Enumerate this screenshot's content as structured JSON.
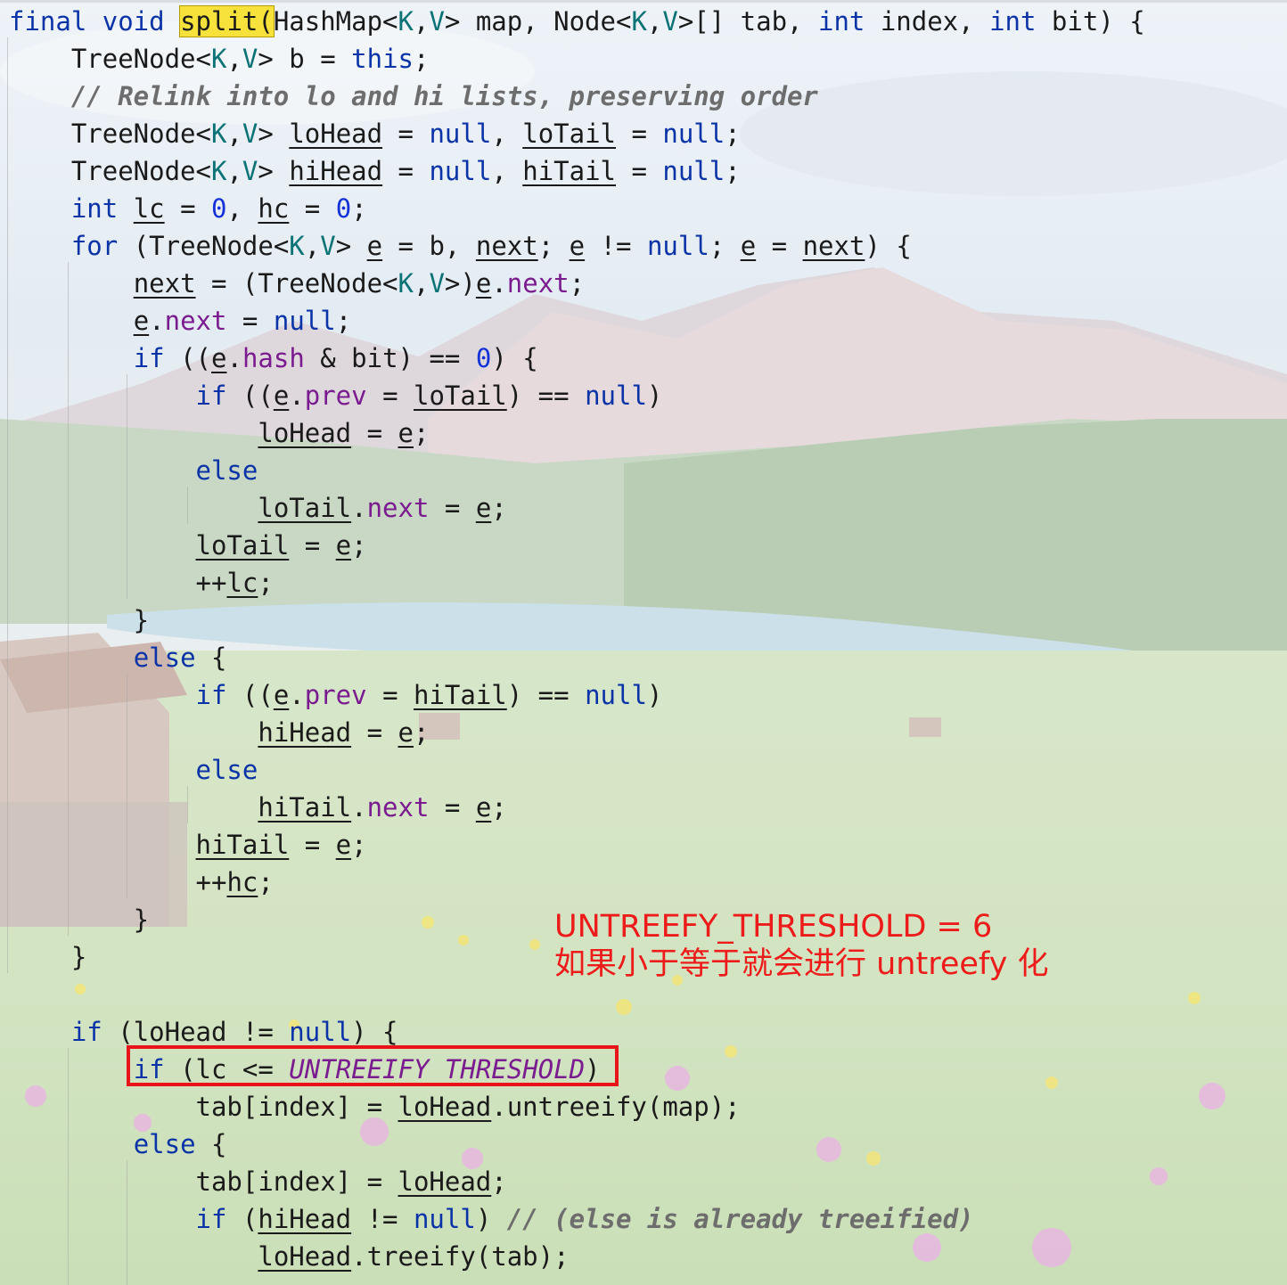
{
  "code_lines": [
    [
      {
        "t": "final void ",
        "c": "kw"
      },
      {
        "t": "split(",
        "c": "hl"
      },
      {
        "t": "HashMap<"
      },
      {
        "t": "K",
        "c": "tp"
      },
      {
        "t": ","
      },
      {
        "t": "V",
        "c": "tp"
      },
      {
        "t": "> map, Node<"
      },
      {
        "t": "K",
        "c": "tp"
      },
      {
        "t": ","
      },
      {
        "t": "V",
        "c": "tp"
      },
      {
        "t": ">[] tab, "
      },
      {
        "t": "int",
        "c": "kw"
      },
      {
        "t": " index, "
      },
      {
        "t": "int",
        "c": "kw"
      },
      {
        "t": " bit) {"
      }
    ],
    [
      {
        "t": "    TreeNode<"
      },
      {
        "t": "K",
        "c": "tp"
      },
      {
        "t": ","
      },
      {
        "t": "V",
        "c": "tp"
      },
      {
        "t": "> b = "
      },
      {
        "t": "this",
        "c": "kw"
      },
      {
        "t": ";"
      }
    ],
    [
      {
        "t": "    // Relink into lo and hi lists, preserving order",
        "c": "cm"
      }
    ],
    [
      {
        "t": "    TreeNode<"
      },
      {
        "t": "K",
        "c": "tp"
      },
      {
        "t": ","
      },
      {
        "t": "V",
        "c": "tp"
      },
      {
        "t": "> "
      },
      {
        "t": "loHead",
        "c": "ul"
      },
      {
        "t": " = "
      },
      {
        "t": "null",
        "c": "kw"
      },
      {
        "t": ", "
      },
      {
        "t": "loTail",
        "c": "ul"
      },
      {
        "t": " = "
      },
      {
        "t": "null",
        "c": "kw"
      },
      {
        "t": ";"
      }
    ],
    [
      {
        "t": "    TreeNode<"
      },
      {
        "t": "K",
        "c": "tp"
      },
      {
        "t": ","
      },
      {
        "t": "V",
        "c": "tp"
      },
      {
        "t": "> "
      },
      {
        "t": "hiHead",
        "c": "ul"
      },
      {
        "t": " = "
      },
      {
        "t": "null",
        "c": "kw"
      },
      {
        "t": ", "
      },
      {
        "t": "hiTail",
        "c": "ul"
      },
      {
        "t": " = "
      },
      {
        "t": "null",
        "c": "kw"
      },
      {
        "t": ";"
      }
    ],
    [
      {
        "t": "    "
      },
      {
        "t": "int",
        "c": "kw"
      },
      {
        "t": " "
      },
      {
        "t": "lc",
        "c": "ul"
      },
      {
        "t": " = "
      },
      {
        "t": "0",
        "c": "num"
      },
      {
        "t": ", "
      },
      {
        "t": "hc",
        "c": "ul"
      },
      {
        "t": " = "
      },
      {
        "t": "0",
        "c": "num"
      },
      {
        "t": ";"
      }
    ],
    [
      {
        "t": "    "
      },
      {
        "t": "for",
        "c": "kw"
      },
      {
        "t": " (TreeNode<"
      },
      {
        "t": "K",
        "c": "tp"
      },
      {
        "t": ","
      },
      {
        "t": "V",
        "c": "tp"
      },
      {
        "t": "> "
      },
      {
        "t": "e",
        "c": "ul"
      },
      {
        "t": " = b, "
      },
      {
        "t": "next",
        "c": "ul"
      },
      {
        "t": "; "
      },
      {
        "t": "e",
        "c": "ul"
      },
      {
        "t": " != "
      },
      {
        "t": "null",
        "c": "kw"
      },
      {
        "t": "; "
      },
      {
        "t": "e",
        "c": "ul"
      },
      {
        "t": " = "
      },
      {
        "t": "next",
        "c": "ul"
      },
      {
        "t": ") {"
      }
    ],
    [
      {
        "t": "        "
      },
      {
        "t": "next",
        "c": "ul"
      },
      {
        "t": " = (TreeNode<"
      },
      {
        "t": "K",
        "c": "tp"
      },
      {
        "t": ","
      },
      {
        "t": "V",
        "c": "tp"
      },
      {
        "t": ">)"
      },
      {
        "t": "e",
        "c": "ul"
      },
      {
        "t": "."
      },
      {
        "t": "next",
        "c": "fld"
      },
      {
        "t": ";"
      }
    ],
    [
      {
        "t": "        "
      },
      {
        "t": "e",
        "c": "ul"
      },
      {
        "t": "."
      },
      {
        "t": "next",
        "c": "fld"
      },
      {
        "t": " = "
      },
      {
        "t": "null",
        "c": "kw"
      },
      {
        "t": ";"
      }
    ],
    [
      {
        "t": "        "
      },
      {
        "t": "if",
        "c": "kw"
      },
      {
        "t": " (("
      },
      {
        "t": "e",
        "c": "ul"
      },
      {
        "t": "."
      },
      {
        "t": "hash",
        "c": "fld"
      },
      {
        "t": " & bit) == "
      },
      {
        "t": "0",
        "c": "num"
      },
      {
        "t": ") {"
      }
    ],
    [
      {
        "t": "            "
      },
      {
        "t": "if",
        "c": "kw"
      },
      {
        "t": " (("
      },
      {
        "t": "e",
        "c": "ul"
      },
      {
        "t": "."
      },
      {
        "t": "prev",
        "c": "fld"
      },
      {
        "t": " = "
      },
      {
        "t": "loTail",
        "c": "ul"
      },
      {
        "t": ") == "
      },
      {
        "t": "null",
        "c": "kw"
      },
      {
        "t": ")"
      }
    ],
    [
      {
        "t": "                "
      },
      {
        "t": "loHead",
        "c": "ul"
      },
      {
        "t": " = "
      },
      {
        "t": "e",
        "c": "ul"
      },
      {
        "t": ";"
      }
    ],
    [
      {
        "t": "            "
      },
      {
        "t": "else",
        "c": "kw"
      }
    ],
    [
      {
        "t": "                "
      },
      {
        "t": "loTail",
        "c": "ul"
      },
      {
        "t": "."
      },
      {
        "t": "next",
        "c": "fld"
      },
      {
        "t": " = "
      },
      {
        "t": "e",
        "c": "ul"
      },
      {
        "t": ";"
      }
    ],
    [
      {
        "t": "            "
      },
      {
        "t": "loTail",
        "c": "ul"
      },
      {
        "t": " = "
      },
      {
        "t": "e",
        "c": "ul"
      },
      {
        "t": ";"
      }
    ],
    [
      {
        "t": "            ++"
      },
      {
        "t": "lc",
        "c": "ul"
      },
      {
        "t": ";"
      }
    ],
    [
      {
        "t": "        }"
      }
    ],
    [
      {
        "t": "        "
      },
      {
        "t": "else",
        "c": "kw"
      },
      {
        "t": " {"
      }
    ],
    [
      {
        "t": "            "
      },
      {
        "t": "if",
        "c": "kw"
      },
      {
        "t": " (("
      },
      {
        "t": "e",
        "c": "ul"
      },
      {
        "t": "."
      },
      {
        "t": "prev",
        "c": "fld"
      },
      {
        "t": " = "
      },
      {
        "t": "hiTail",
        "c": "ul"
      },
      {
        "t": ") == "
      },
      {
        "t": "null",
        "c": "kw"
      },
      {
        "t": ")"
      }
    ],
    [
      {
        "t": "                "
      },
      {
        "t": "hiHead",
        "c": "ul"
      },
      {
        "t": " = "
      },
      {
        "t": "e",
        "c": "ul"
      },
      {
        "t": ";"
      }
    ],
    [
      {
        "t": "            "
      },
      {
        "t": "else",
        "c": "kw"
      }
    ],
    [
      {
        "t": "                "
      },
      {
        "t": "hiTail",
        "c": "ul"
      },
      {
        "t": "."
      },
      {
        "t": "next",
        "c": "fld"
      },
      {
        "t": " = "
      },
      {
        "t": "e",
        "c": "ul"
      },
      {
        "t": ";"
      }
    ],
    [
      {
        "t": "            "
      },
      {
        "t": "hiTail",
        "c": "ul"
      },
      {
        "t": " = "
      },
      {
        "t": "e",
        "c": "ul"
      },
      {
        "t": ";"
      }
    ],
    [
      {
        "t": "            ++"
      },
      {
        "t": "hc",
        "c": "ul"
      },
      {
        "t": ";"
      }
    ],
    [
      {
        "t": "        }"
      }
    ],
    [
      {
        "t": "    }"
      }
    ],
    [],
    [
      {
        "t": "    "
      },
      {
        "t": "if",
        "c": "kw"
      },
      {
        "t": " ("
      },
      {
        "t": "loHead",
        "c": "ul"
      },
      {
        "t": " != "
      },
      {
        "t": "null",
        "c": "kw"
      },
      {
        "t": ") {"
      }
    ],
    [
      {
        "t": "        "
      },
      {
        "t": "if",
        "c": "kw"
      },
      {
        "t": " ("
      },
      {
        "t": "lc",
        "c": "ul"
      },
      {
        "t": " <= "
      },
      {
        "t": "UNTREEIFY_THRESHOLD",
        "c": "cst"
      },
      {
        "t": ")"
      }
    ],
    [
      {
        "t": "            tab[index] = "
      },
      {
        "t": "loHead",
        "c": "ul"
      },
      {
        "t": ".untreeify(map);"
      }
    ],
    [
      {
        "t": "        "
      },
      {
        "t": "else",
        "c": "kw"
      },
      {
        "t": " {"
      }
    ],
    [
      {
        "t": "            tab[index] = "
      },
      {
        "t": "loHead",
        "c": "ul"
      },
      {
        "t": ";"
      }
    ],
    [
      {
        "t": "            "
      },
      {
        "t": "if",
        "c": "kw"
      },
      {
        "t": " ("
      },
      {
        "t": "hiHead",
        "c": "ul"
      },
      {
        "t": " != "
      },
      {
        "t": "null",
        "c": "kw"
      },
      {
        "t": ") "
      },
      {
        "t": "// (else is already treeified)",
        "c": "cm"
      }
    ],
    [
      {
        "t": "                "
      },
      {
        "t": "loHead",
        "c": "ul"
      },
      {
        "t": ".treeify(tab);"
      }
    ]
  ],
  "annotation": {
    "line1": "UNTREEFY_THRESHOLD = 6",
    "line2": "如果小于等于就会进行 untreefy 化"
  },
  "colors": {
    "keyword": "#0b33a8",
    "type_param": "#0b7376",
    "field": "#7a1b8f",
    "number": "#1432d8",
    "comment": "#6d6d6d",
    "highlight": "#f6e23a",
    "annotation_red": "#e8141a"
  }
}
